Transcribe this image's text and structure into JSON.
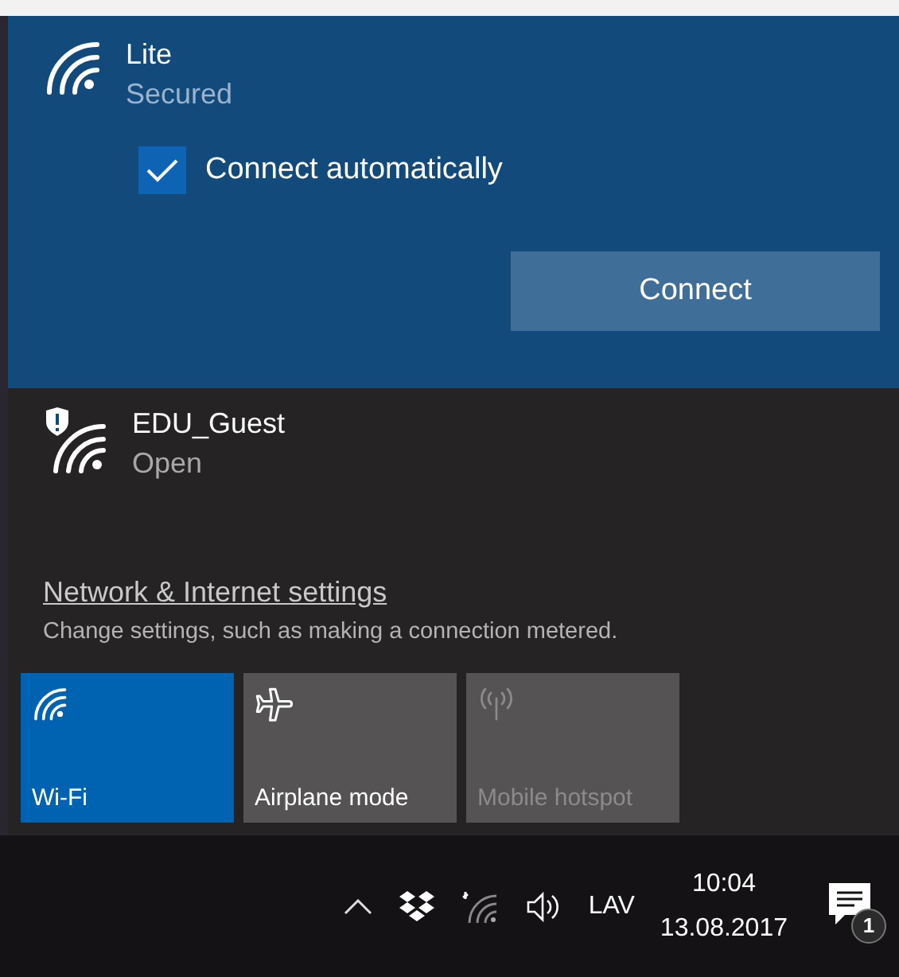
{
  "networks": [
    {
      "name": "Lite",
      "status": "Secured",
      "expanded": true,
      "warning": false,
      "connect_automatically": {
        "label": "Connect automatically",
        "checked": true
      },
      "button": "Connect"
    },
    {
      "name": "EDU_Guest",
      "status": "Open",
      "expanded": false,
      "warning": true
    }
  ],
  "settings": {
    "link": "Network & Internet settings",
    "description": "Change settings, such as making a connection metered."
  },
  "quick_actions": [
    {
      "kind": "wifi",
      "label": "Wi-Fi",
      "selected": true,
      "disabled": false
    },
    {
      "kind": "airplane",
      "label": "Airplane mode",
      "selected": false,
      "disabled": false
    },
    {
      "kind": "hotspot",
      "label": "Mobile hotspot",
      "selected": false,
      "disabled": true
    }
  ],
  "taskbar": {
    "language": "LAV",
    "time": "10:04",
    "date": "13.08.2017",
    "notifications": "1"
  }
}
